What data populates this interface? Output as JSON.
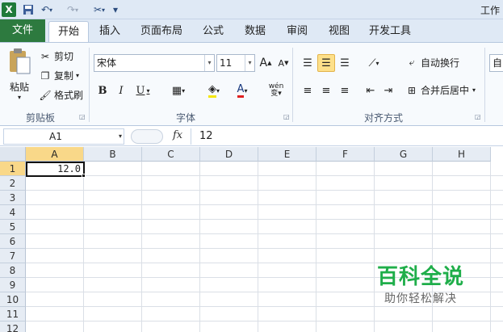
{
  "window": {
    "title_fragment": "工作"
  },
  "qat": {
    "logo": "X",
    "customize_label": "▾"
  },
  "tabs": [
    {
      "id": "file",
      "label": "文件"
    },
    {
      "id": "home",
      "label": "开始"
    },
    {
      "id": "insert",
      "label": "插入"
    },
    {
      "id": "layout",
      "label": "页面布局"
    },
    {
      "id": "formulas",
      "label": "公式"
    },
    {
      "id": "data",
      "label": "数据"
    },
    {
      "id": "review",
      "label": "审阅"
    },
    {
      "id": "view",
      "label": "视图"
    },
    {
      "id": "developer",
      "label": "开发工具"
    }
  ],
  "clipboard": {
    "group_label": "剪贴板",
    "paste_label": "粘贴",
    "cut_label": "剪切",
    "copy_label": "复制",
    "format_painter_label": "格式刷"
  },
  "font": {
    "group_label": "字体",
    "font_name": "宋体",
    "font_size": "11",
    "grow_label": "A",
    "shrink_label": "A",
    "bold_label": "B",
    "italic_label": "I",
    "underline_label": "U",
    "font_color_label": "A",
    "phonetic_label": "wén"
  },
  "alignment": {
    "group_label": "对齐方式",
    "wrap_text_label": "自动换行",
    "merge_center_label": "合并后居中",
    "cut_off_label": "自"
  },
  "formula_bar": {
    "name_box": "A1",
    "fx_label": "fx",
    "content": "12"
  },
  "grid": {
    "columns": [
      "A",
      "B",
      "C",
      "D",
      "E",
      "F",
      "G",
      "H"
    ],
    "rows": [
      "1",
      "2",
      "3",
      "4",
      "5",
      "6",
      "7",
      "8",
      "9",
      "10",
      "11",
      "12"
    ],
    "active_cell_value": "12.0"
  },
  "watermark": {
    "title": "百科全说",
    "subtitle": "助你轻松解决"
  },
  "colors": {
    "file_tab": "#2d7a3f",
    "selection_header": "#f9d889",
    "watermark": "#1fae4a"
  }
}
